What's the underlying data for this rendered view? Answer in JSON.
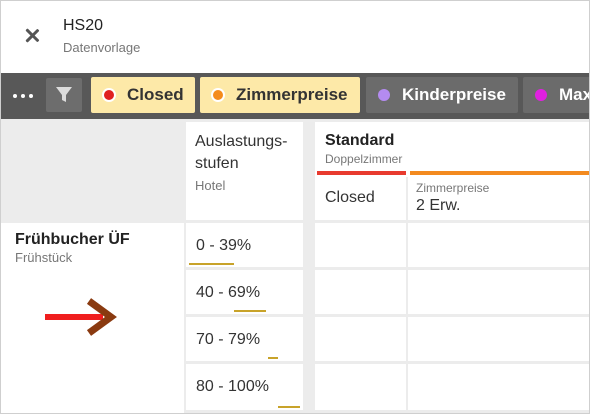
{
  "header": {
    "title": "HS20",
    "subtitle": "Datenvorlage"
  },
  "toolbar": {
    "chips": [
      {
        "label": "Closed",
        "color": "#e02020",
        "active": true
      },
      {
        "label": "Zimmerpreise",
        "color": "#f48c1c",
        "active": true
      },
      {
        "label": "Kinderpreise",
        "color": "#b48bf0",
        "active": false
      },
      {
        "label": "Max",
        "color": "#e020e0",
        "active": false
      }
    ]
  },
  "grid": {
    "column_header": {
      "label": "Auslastungs-stufen",
      "label_line1": "Auslastungs-",
      "label_line2": "stufen",
      "sub": "Hotel"
    },
    "room": {
      "title": "Standard",
      "sub": "Doppelzimmer",
      "bar_colors": [
        "#e83a2e",
        "#f38a1f"
      ]
    },
    "subcolumns": {
      "closed": "Closed",
      "zimmerpreise_label": "Zimmerpreise",
      "zimmerpreise_value": "2 Erw."
    },
    "row": {
      "label": "Frühbucher ÜF",
      "sub": "Frühstück"
    },
    "levels": [
      {
        "label": "0 - 39%"
      },
      {
        "label": "40 - 69%"
      },
      {
        "label": "70 - 79%"
      },
      {
        "label": "80 - 100%"
      }
    ]
  }
}
